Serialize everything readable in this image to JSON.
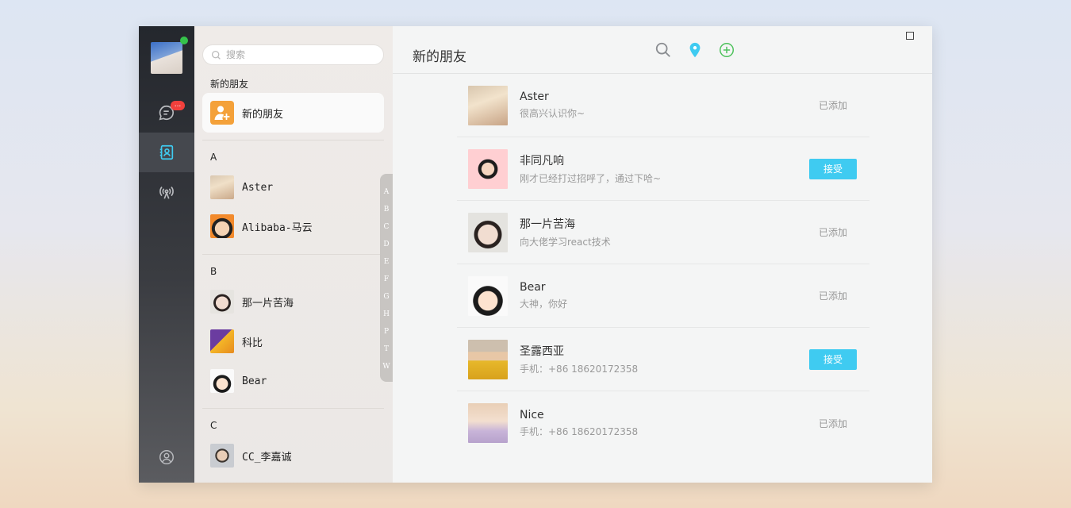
{
  "nav": {
    "message_badge": "..."
  },
  "sidebar": {
    "search_placeholder": "搜索",
    "new_friends_group": "新的朋友",
    "new_friends_item": "新的朋友",
    "groups": [
      {
        "letter": "A",
        "contacts": [
          {
            "name": "Aster"
          },
          {
            "name": "Alibaba-马云"
          }
        ]
      },
      {
        "letter": "B",
        "contacts": [
          {
            "name": "那一片苦海"
          },
          {
            "name": "科比"
          },
          {
            "name": "Bear"
          }
        ]
      },
      {
        "letter": "C",
        "contacts": [
          {
            "name": "CC_李嘉诚"
          }
        ]
      }
    ],
    "alphabet": [
      "A",
      "B",
      "C",
      "D",
      "E",
      "F",
      "G",
      "H",
      "P",
      "T",
      "W"
    ]
  },
  "main": {
    "title": "新的朋友",
    "requests": [
      {
        "name": "Aster",
        "message": "很高兴认识你~",
        "status": "已添加"
      },
      {
        "name": "非同凡响",
        "message": "刚才已经打过招呼了，通过下哈~",
        "action": "接受"
      },
      {
        "name": "那一片苦海",
        "message": "向大佬学习react技术",
        "status": "已添加"
      },
      {
        "name": "Bear",
        "message": "大神，你好",
        "status": "已添加"
      },
      {
        "name": "圣露西亚",
        "message": "手机：+86 18620172358",
        "action": "接受"
      },
      {
        "name": "Nice",
        "message": "手机：+86 18620172358",
        "status": "已添加"
      }
    ]
  },
  "icons": {
    "nav": [
      "chat-icon",
      "contacts-icon",
      "broadcast-icon",
      "user-icon"
    ],
    "header": [
      "search-icon",
      "location-pin-icon",
      "add-circle-icon"
    ]
  },
  "colors": {
    "accent": "#3fcbf1",
    "new_friend_icon": "#f4a13a",
    "online": "#35c24a",
    "badge": "#f2403c",
    "add_icon": "#4cc15a"
  }
}
